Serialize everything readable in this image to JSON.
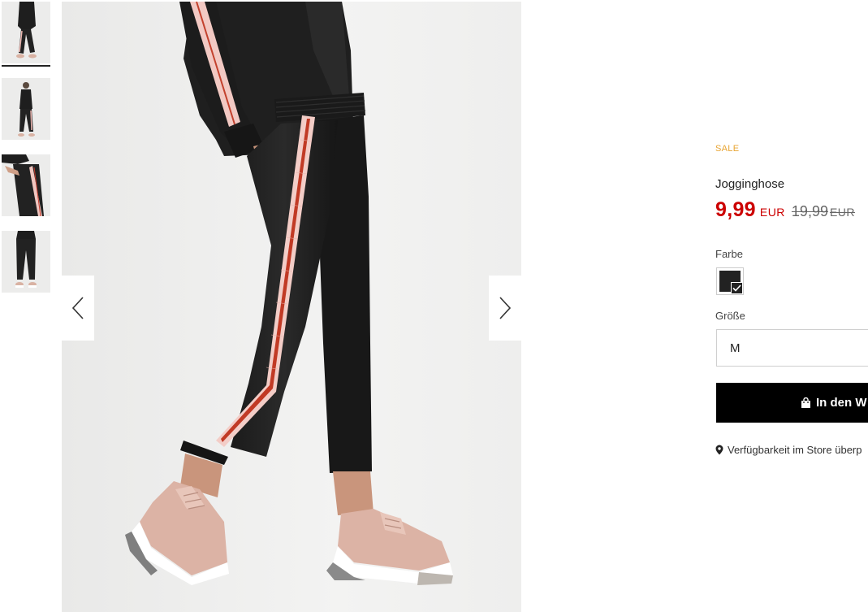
{
  "gallery": {
    "thumbnails": [
      {
        "alt": "thumbnail-1",
        "active": true
      },
      {
        "alt": "thumbnail-2",
        "active": false
      },
      {
        "alt": "thumbnail-3",
        "active": false
      },
      {
        "alt": "thumbnail-4",
        "active": false
      }
    ],
    "prev_icon": "chevron-left-icon",
    "next_icon": "chevron-right-icon"
  },
  "product": {
    "badge": "SALE",
    "name": "Jogginghose",
    "price_current": "9,99",
    "price_current_currency": "EUR",
    "price_old": "19,99",
    "price_old_currency": "EUR",
    "color_label": "Farbe",
    "color_selected_hex": "#222222",
    "size_label": "Größe",
    "size_value": "M",
    "cart_label": "In den W",
    "store_label": "Verfügbarkeit im Store überp"
  },
  "colors": {
    "sale": "#e8a431",
    "price": "#cc0000",
    "button": "#000000"
  }
}
